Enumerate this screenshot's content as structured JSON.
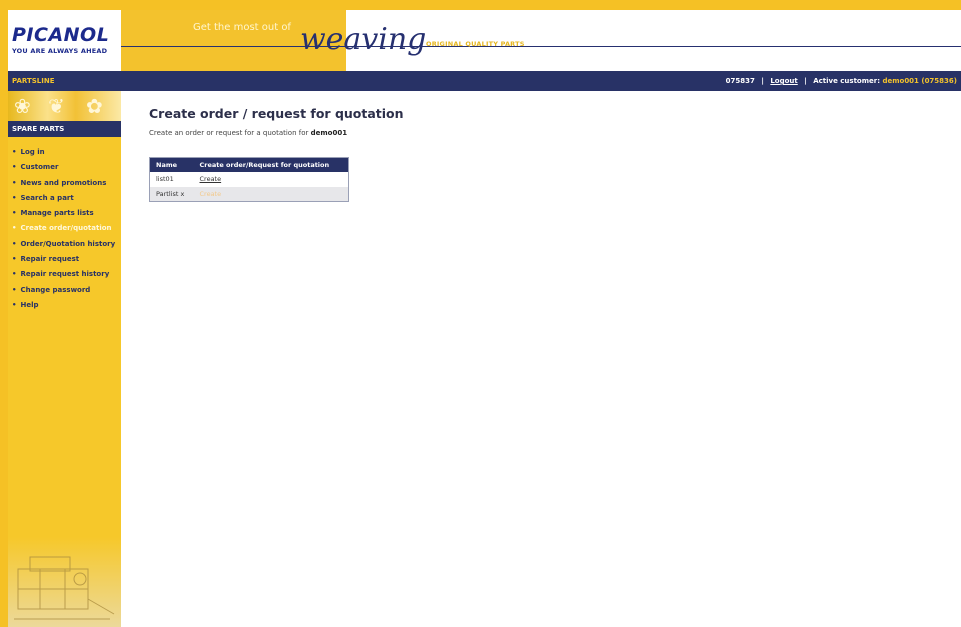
{
  "header": {
    "logo": "PICANOL",
    "tagline": "YOU ARE ALWAYS AHEAD",
    "slogan": "Get the most out of",
    "slogan_script": "weaving",
    "oqp": "ORIGINAL QUALITY PARTS"
  },
  "topbar": {
    "brand": "PARTSLINE",
    "user_id": "075837",
    "logout_label": "Logout",
    "active_customer_label": "Active customer:",
    "active_customer_value": "demo001 (075836)"
  },
  "sidebar": {
    "title": "SPARE PARTS",
    "items": [
      {
        "label": "Log in"
      },
      {
        "label": "Customer"
      },
      {
        "label": "News and promotions"
      },
      {
        "label": "Search a part"
      },
      {
        "label": "Manage parts lists"
      },
      {
        "label": "Create order/quotation"
      },
      {
        "label": "Order/Quotation history"
      },
      {
        "label": "Repair request"
      },
      {
        "label": "Repair request history"
      },
      {
        "label": "Change password"
      },
      {
        "label": "Help"
      }
    ]
  },
  "main": {
    "title": "Create order / request for quotation",
    "subtitle_prefix": "Create an order or request for a quotation for",
    "subtitle_customer": "demo001",
    "table": {
      "headers": [
        "Name",
        "Create order/Request for quotation"
      ],
      "rows": [
        {
          "name": "list01",
          "action": "Create"
        },
        {
          "name": "Partlist x",
          "action": "Create"
        }
      ]
    }
  },
  "colors": {
    "accent_yellow": "#f5c125",
    "navy": "#283266"
  }
}
